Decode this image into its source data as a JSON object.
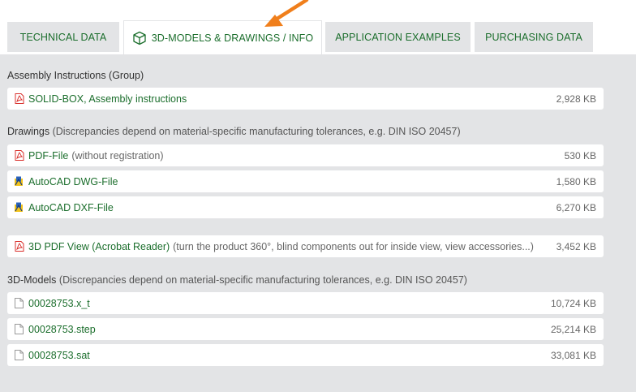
{
  "tabs": [
    {
      "label": "TECHNICAL DATA",
      "active": false
    },
    {
      "label": "3D-MODELS & DRAWINGS / INFO",
      "active": true,
      "icon": "cube-icon"
    },
    {
      "label": "APPLICATION EXAMPLES",
      "active": false
    },
    {
      "label": "PURCHASING DATA",
      "active": false
    }
  ],
  "colors": {
    "accent": "#1b6e2c",
    "background": "#e3e4e6",
    "arrow": "#f07f1c",
    "pdf": "#d9302c"
  },
  "assembly": {
    "title": "Assembly Instructions (Group)",
    "items": [
      {
        "name": "SOLID-BOX, Assembly instructions",
        "size": "2,928 KB",
        "icon": "pdf-icon"
      }
    ]
  },
  "drawings": {
    "title": "Drawings",
    "note": "(Discrepancies depend on material-specific manufacturing tolerances, e.g. DIN ISO 20457)",
    "items": [
      {
        "name": "PDF-File",
        "desc": "(without registration)",
        "size": "530 KB",
        "icon": "pdf-icon"
      },
      {
        "name": "AutoCAD DWG-File",
        "size": "1,580 KB",
        "icon": "autocad-icon"
      },
      {
        "name": "AutoCAD DXF-File",
        "size": "6,270 KB",
        "icon": "autocad-icon"
      }
    ]
  },
  "pdf3d": {
    "name": "3D PDF View (Acrobat Reader)",
    "desc": "(turn the product 360°, blind components out for inside view, view accessories...)",
    "size": "3,452 KB",
    "icon": "pdf-icon"
  },
  "models": {
    "title": "3D-Models",
    "note": "(Discrepancies depend on material-specific manufacturing tolerances, e.g. DIN ISO 20457)",
    "items": [
      {
        "name": "00028753.x_t",
        "size": "10,724 KB",
        "icon": "file-icon"
      },
      {
        "name": "00028753.step",
        "size": "25,214 KB",
        "icon": "file-icon"
      },
      {
        "name": "00028753.sat",
        "size": "33,081 KB",
        "icon": "file-icon"
      }
    ]
  }
}
